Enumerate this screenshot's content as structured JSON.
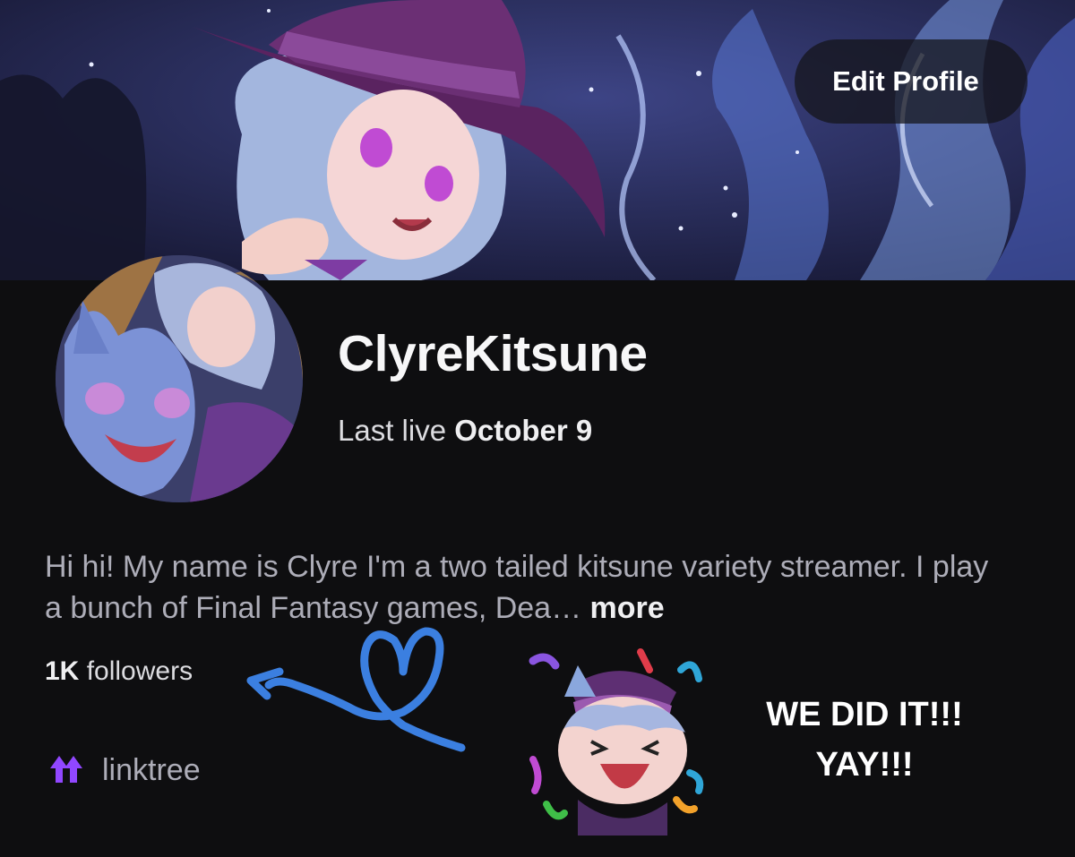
{
  "profile": {
    "edit_button": "Edit Profile",
    "username": "ClyreKitsune",
    "last_live_label": "Last live",
    "last_live_date": "October 9",
    "bio_text": "Hi hi! My name is Clyre I'm a two tailed kitsune variety streamer. I play a bunch of Final Fantasy games, Dea…",
    "bio_more": "more",
    "followers_count": "1K",
    "followers_label": "followers",
    "link_label": "linktree",
    "link_icon": "linktree-icon"
  },
  "overlay": {
    "celebrate_line1": "WE DID IT!!!",
    "celebrate_line2": "YAY!!!",
    "scribble_color": "#3b7fe0"
  },
  "colors": {
    "background": "#0e0e10",
    "accent": "#9147ff",
    "text_primary": "#efeff1",
    "text_secondary": "#adadb8"
  }
}
